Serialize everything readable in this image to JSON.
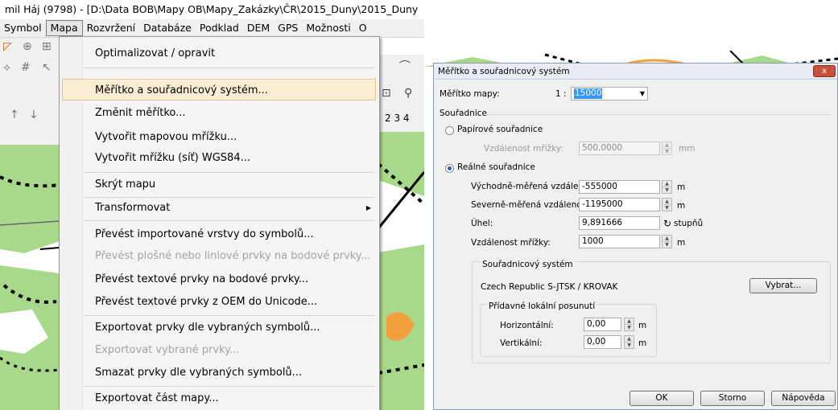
{
  "window": {
    "title": "mil Háj (9798) - [D:\\Data BOB\\Mapy OB\\Mapy_Zakázky\\ČR\\2015_Duny\\2015_Duny"
  },
  "menubar": {
    "items": [
      "Symbol",
      "Mapa",
      "Rozvržení",
      "Databáze",
      "Podklad",
      "DEM",
      "GPS",
      "Možnosti",
      "O"
    ],
    "active": "Mapa"
  },
  "toolbar_right": {
    "numbers": "2 3 4"
  },
  "mapa_menu": {
    "items": [
      {
        "label": "Optimalizovat / opravit"
      },
      {
        "label": "Měřítko a souřadnicový systém...",
        "highlighted": true
      },
      {
        "label": "Změnit měřítko..."
      },
      {
        "label": "Vytvořit mapovou mřížku..."
      },
      {
        "label": "Vytvořit mřížku (síť) WGS84..."
      },
      {
        "label": "Skrýt mapu"
      },
      {
        "label": "Transformovat",
        "submenu": true
      },
      {
        "label": "Převést importované vrstvy do symbolů..."
      },
      {
        "label": "Převést plošné nebo liniové prvky na bodové prvky...",
        "disabled": true
      },
      {
        "label": "Převést textové prvky na bodové prvky..."
      },
      {
        "label": "Převést textové prvky z OEM do Unicode..."
      },
      {
        "label": "Exportovat prvky dle vybraných symbolů..."
      },
      {
        "label": "Exportovat vybrané prvky...",
        "disabled": true
      },
      {
        "label": "Smazat prvky dle vybraných symbolů..."
      },
      {
        "label": "Exportovat část mapy..."
      }
    ]
  },
  "dialog": {
    "title": "Měřítko a souřadnicový systém",
    "close_label": "x",
    "scale_label": "Měřítko mapy:",
    "scale_prefix": "1 :",
    "scale_value": "15000",
    "coords_group": "Souřadnice",
    "paper": {
      "label": "Papírové souřadnice",
      "grid_label": "Vzdálenost mřížky:",
      "grid_value": "500,0000",
      "grid_unit": "mm"
    },
    "real": {
      "label": "Reálné souřadnice",
      "east_label": "Východně-měřená vzdálen",
      "east_value": "-555000",
      "east_unit": "m",
      "north_label": "Severně-měřená vzdálenos",
      "north_value": "-1195000",
      "north_unit": "m",
      "angle_label": "Úhel:",
      "angle_value": "9,891666",
      "angle_unit": "stupňů",
      "grid_label": "Vzdálenost mřížky:",
      "grid_value": "1000",
      "grid_unit": "m"
    },
    "coordsys": {
      "group": "Souřadnicový systém",
      "name": "Czech Republic  S-JTSK / KROVAK",
      "select_button": "Vybrat..."
    },
    "offset": {
      "group": "Přídavné lokální posunutí",
      "horizontal_label": "Horizontální:",
      "horizontal_value": "0,00",
      "horizontal_unit": "m",
      "vertical_label": "Vertikální:",
      "vertical_value": "0,00",
      "vertical_unit": "m"
    },
    "buttons": {
      "ok": "OK",
      "cancel": "Storno",
      "help": "Nápověda"
    },
    "selected_coords": "real"
  },
  "colors": {
    "map_green": "#a8d98a",
    "map_orange": "#f2a03d",
    "highlight_fill": "#fbeed2",
    "highlight_border": "#e5c58b",
    "select_blue": "#3399ff"
  }
}
